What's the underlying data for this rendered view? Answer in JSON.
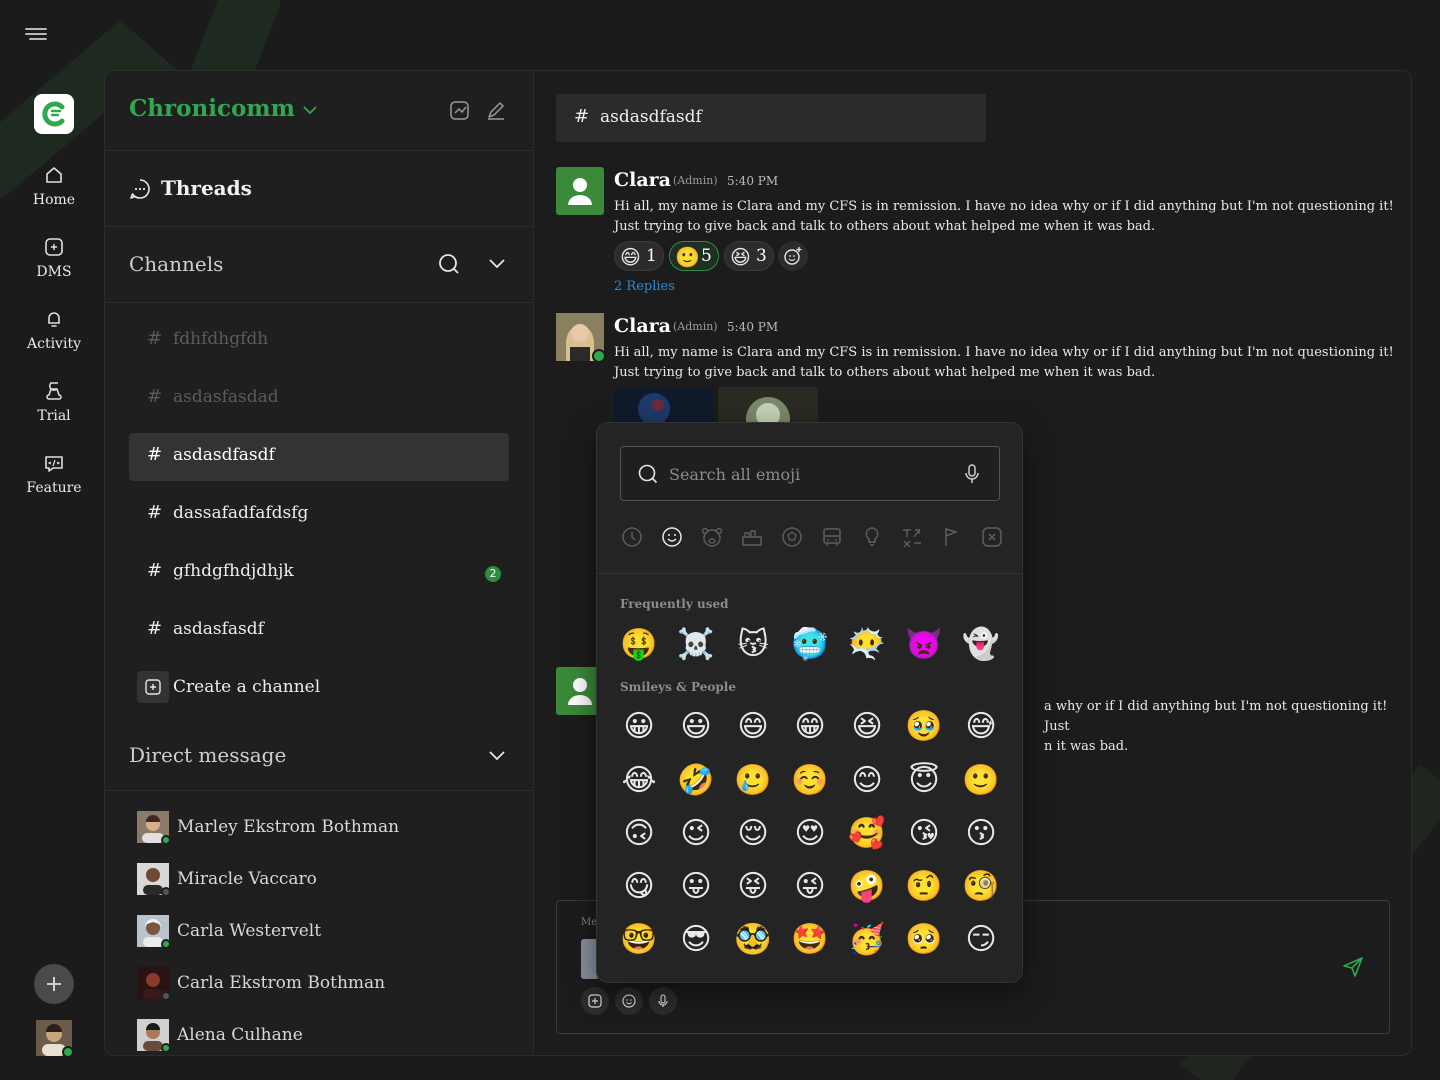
{
  "workspace": {
    "name": "Chronicomm",
    "brand_color": "#2fa84f"
  },
  "rail": {
    "items": [
      {
        "label": "Home",
        "icon": "home-icon"
      },
      {
        "label": "DMS",
        "icon": "dm-icon"
      },
      {
        "label": "Activity",
        "icon": "bell-icon"
      },
      {
        "label": "Trial",
        "icon": "flask-icon"
      },
      {
        "label": "Feature",
        "icon": "feature-icon"
      }
    ]
  },
  "sidebar": {
    "threads_label": "Threads",
    "channels_label": "Channels",
    "channels": [
      {
        "name": "fdhfdhgfdh",
        "state": "muted"
      },
      {
        "name": "asdasfasdad",
        "state": "muted"
      },
      {
        "name": "asdasdfasdf",
        "state": "active"
      },
      {
        "name": "dassafadfafdsfg",
        "state": "normal"
      },
      {
        "name": "gfhdgfhdjdhjk",
        "state": "normal",
        "badge": "2"
      },
      {
        "name": "asdasfasdf",
        "state": "normal"
      }
    ],
    "create_channel_label": "Create a channel",
    "dm_label": "Direct message",
    "dms": [
      {
        "name": "Marley Ekstrom Bothman",
        "online": true
      },
      {
        "name": "Miracle Vaccaro",
        "online": false
      },
      {
        "name": "Carla Westervelt",
        "online": true
      },
      {
        "name": "Carla Ekstrom Bothman",
        "online": false
      },
      {
        "name": "Alena Culhane",
        "online": true
      }
    ]
  },
  "channel": {
    "hash": "#",
    "title": "asdasdfasdf"
  },
  "messages": [
    {
      "author": "Clara",
      "role": "(Admin)",
      "time": "5:40 PM",
      "text": "Hi all, my name is Clara and my CFS is in remission. I have no idea why or if I did anything but I'm not questioning it! Just trying to give back and talk to others about what helped me when it was bad.",
      "reactions": [
        {
          "emoji": "😄",
          "count": "1",
          "selected": false
        },
        {
          "emoji": "🙂",
          "count": "5",
          "selected": true
        },
        {
          "emoji": "😆",
          "count": "3",
          "selected": false
        }
      ],
      "replies": "2 Replies"
    },
    {
      "author": "Clara",
      "role": "(Admin)",
      "time": "5:40 PM",
      "text": "Hi all, my name is Clara and my CFS is in remission. I have no idea why or if I did anything but I'm not questioning it! Just trying to give back and talk to others about what helped me when it was bad."
    },
    {
      "visible_text_line1": "a why or if I did anything but I'm not questioning it! Just",
      "visible_text_line2": "n it was bad."
    }
  ],
  "composer": {
    "placeholder": "Me"
  },
  "emoji_picker": {
    "search_placeholder": "Search all emoji",
    "categories": [
      "clock-icon",
      "smiley-icon",
      "animal-icon",
      "food-icon",
      "ball-icon",
      "car-icon",
      "bulb-icon",
      "symbols-icon",
      "flag-icon",
      "close-icon"
    ],
    "frequent_label": "Frequently used",
    "frequent": [
      "🤑",
      "☠️",
      "😽",
      "🥶",
      "😶‍🌫️",
      "👿",
      "👻"
    ],
    "smileys_label": "Smileys & People",
    "smileys": [
      "😀",
      "😃",
      "😄",
      "😁",
      "😆",
      "🥹",
      "😅",
      "😂",
      "🤣",
      "🥲",
      "☺️",
      "😊",
      "😇",
      "🙂",
      "🙃",
      "😉",
      "😌",
      "😍",
      "🥰",
      "😘",
      "😗",
      "😋",
      "😛",
      "😝",
      "😜",
      "🤪",
      "🤨",
      "🧐",
      "🤓",
      "😎",
      "🥸",
      "🤩",
      "🥳",
      "🥺",
      "😏"
    ]
  }
}
